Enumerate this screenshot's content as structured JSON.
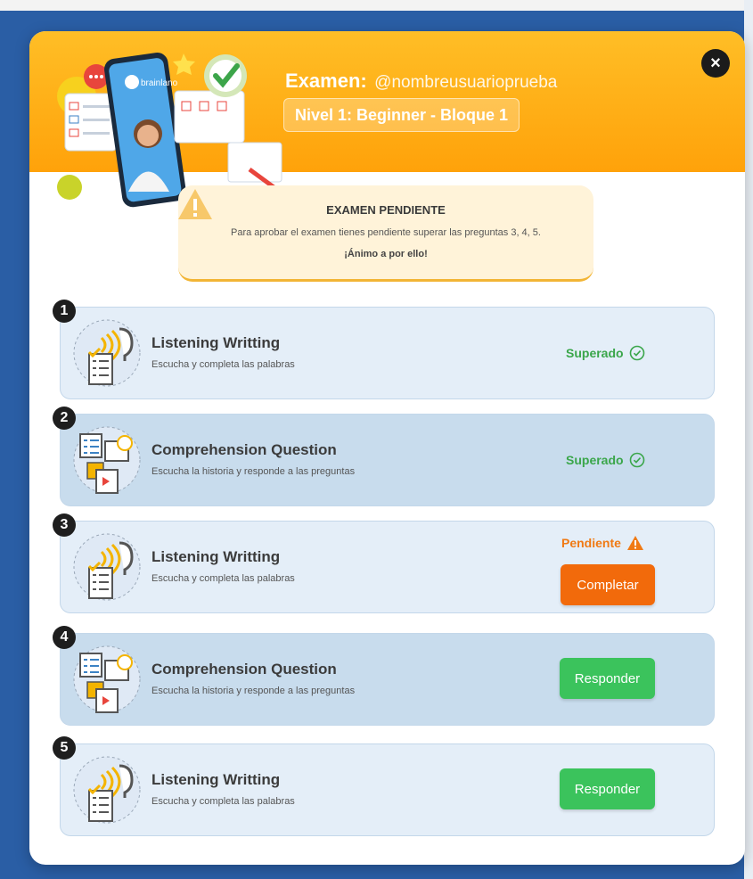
{
  "header": {
    "title_bold": "Examen:",
    "username": "@nombreusuarioprueba",
    "level": "Nivel 1: Beginner - Bloque 1",
    "close_symbol": "×",
    "hero_brand": "brainlano"
  },
  "alert": {
    "title": "EXAMEN PENDIENTE",
    "text": "Para aprobar el examen tienes pendiente superar las preguntas 3, 4, 5.",
    "cheer": "¡Ánimo a por ello!"
  },
  "cards": [
    {
      "num": "1",
      "title": "Listening Writting",
      "subtitle": "Escucha y completa las palabras",
      "status": "Superado"
    },
    {
      "num": "2",
      "title": "Comprehension Question",
      "subtitle": "Escucha la historia y responde a las preguntas",
      "status": "Superado"
    },
    {
      "num": "3",
      "title": "Listening Writting",
      "subtitle": "Escucha y completa las palabras",
      "status": "Pendiente",
      "button": "Completar"
    },
    {
      "num": "4",
      "title": "Comprehension Question",
      "subtitle": "Escucha la historia y responde a las preguntas",
      "button": "Responder"
    },
    {
      "num": "5",
      "title": "Listening Writting",
      "subtitle": "Escucha y completa las palabras",
      "button": "Responder"
    }
  ],
  "icons": {
    "close": "close-icon",
    "alert": "warning-icon",
    "passed": "check-circle-icon",
    "pending": "warning-triangle-icon",
    "listening": "ear-audio-checklist-icon",
    "comprehension": "documents-video-icon"
  },
  "colors": {
    "header": "#ffa20a",
    "passed": "#3aa64a",
    "pending": "#f07a14",
    "button_complete": "#f26a0b",
    "button_respond": "#3bc35c",
    "card_light": "#e4eef8",
    "card_dark": "#c8dced"
  }
}
